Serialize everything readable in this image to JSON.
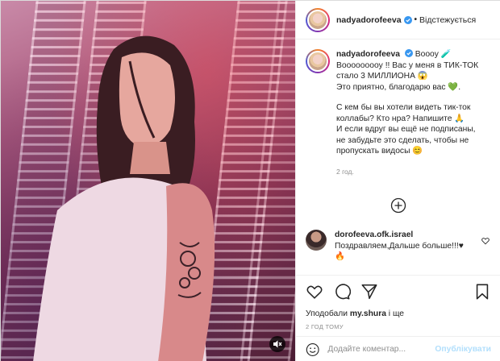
{
  "post": {
    "author": "nadyadorofeeva",
    "follow_status": "Відстежується",
    "dot": "•"
  },
  "caption": {
    "username": "nadyadorofeeva",
    "lines": [
      "Boooy 🧪",
      "Booooooooy !! Вас у меня в ТИК-ТОК",
      "стало 3 МИЛЛИОНА 😱",
      "Это приятно, благодарю вас 💚.",
      "С кем бы вы хотели видеть тик-ток",
      "коллабы? Кто нра? Напишите 🙏",
      "И если вдруг вы ещё не подписаны,",
      "не забудьте это сделать, чтобы не",
      "пропускать видосы 😊"
    ],
    "time": "2 год."
  },
  "comment": {
    "username": "dorofeeva.ofk.israel",
    "text": "Поздравляем,Дальше больше!!!♥",
    "text2": "🔥"
  },
  "likes": {
    "prefix": "Уподобали ",
    "user": "my.shura",
    "suffix": " і ще"
  },
  "timestamp": "2 ГОД ТОМУ",
  "composer": {
    "placeholder": "Додайте коментар...",
    "publish": "Опублікувати"
  },
  "icons": {
    "verified": "verified-badge-icon",
    "heart": "heart-icon",
    "comment": "comment-icon",
    "share": "share-icon",
    "save": "bookmark-icon",
    "emoji": "emoji-icon",
    "load_more": "plus-circle-icon",
    "mute": "mute-icon"
  },
  "colors": {
    "accent": "#0095f6",
    "publish_disabled": "#b2dffc",
    "muted_text": "#8e8e8e"
  }
}
